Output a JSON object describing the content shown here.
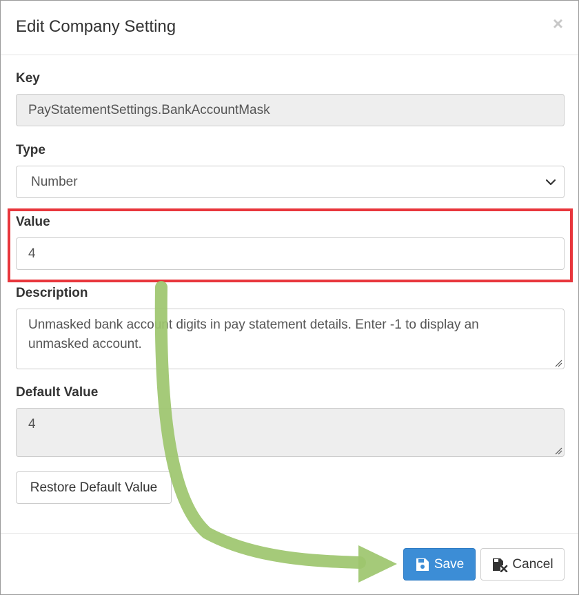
{
  "dialog": {
    "title": "Edit Company Setting",
    "close_glyph": "×"
  },
  "form": {
    "key": {
      "label": "Key",
      "value": "PayStatementSettings.BankAccountMask"
    },
    "type": {
      "label": "Type",
      "selected": "Number"
    },
    "value": {
      "label": "Value",
      "value": "4"
    },
    "description": {
      "label": "Description",
      "value": "Unmasked bank account digits in pay statement details. Enter -1 to display an unmasked account."
    },
    "default_value": {
      "label": "Default Value",
      "value": "4"
    },
    "restore_label": "Restore Default Value"
  },
  "footer": {
    "save_label": "Save",
    "cancel_label": "Cancel"
  },
  "annotation": {
    "highlight_color": "#e8363c",
    "arrow_color": "#9dc56e",
    "arrow_icon": "curved-arrow-icon"
  },
  "icons": {
    "save": "save-icon",
    "cancel": "cancel-icon",
    "chevron": "chevron-down-icon",
    "close": "close-icon"
  }
}
